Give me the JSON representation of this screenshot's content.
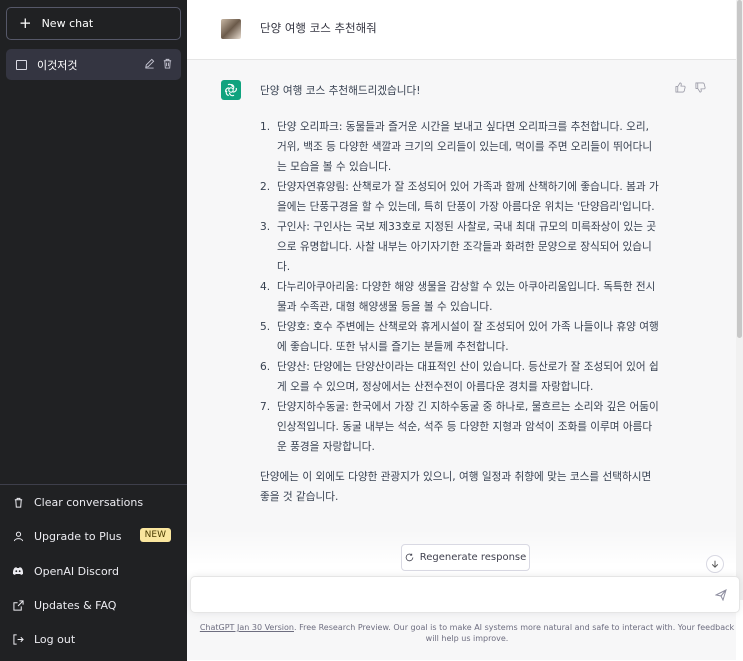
{
  "sidebar": {
    "new_chat_label": "New chat",
    "chat_item_label": "이것저것",
    "menu": {
      "clear": "Clear conversations",
      "upgrade": "Upgrade to Plus",
      "upgrade_badge": "NEW",
      "discord": "OpenAI Discord",
      "updates": "Updates & FAQ",
      "logout": "Log out"
    }
  },
  "conversation": {
    "user_message": "단양 여행 코스 추천해줘",
    "bot_intro": "단양 여행 코스 추천해드리겠습니다!",
    "items": [
      {
        "num": "1.",
        "text": "단양 오리파크: 동물들과 즐거운 시간을 보내고 싶다면 오리파크를 추천합니다. 오리, 거위, 백조 등 다양한 색깔과 크기의 오리들이 있는데, 먹이를 주면 오리들이 뛰어다니는 모습을 볼 수 있습니다."
      },
      {
        "num": "2.",
        "text": "단양자연휴양림: 산책로가 잘 조성되어 있어 가족과 함께 산책하기에 좋습니다. 봄과 가을에는 단풍구경을 할 수 있는데, 특히 단풍이 가장 아름다운 위치는 '단양읍리'입니다."
      },
      {
        "num": "3.",
        "text": "구인사: 구인사는 국보 제33호로 지정된 사찰로, 국내 최대 규모의 미륵좌상이 있는 곳으로 유명합니다. 사찰 내부는 아기자기한 조각들과 화려한 문양으로 장식되어 있습니다."
      },
      {
        "num": "4.",
        "text": "다누리아쿠아리움: 다양한 해양 생물을 감상할 수 있는 아쿠아리움입니다. 독특한 전시물과 수족관, 대형 해양생물 등을 볼 수 있습니다."
      },
      {
        "num": "5.",
        "text": "단양호: 호수 주변에는 산책로와 휴게시설이 잘 조성되어 있어 가족 나들이나 휴양 여행에 좋습니다. 또한 낚시를 즐기는 분들께 추천합니다."
      },
      {
        "num": "6.",
        "text": "단양산: 단양에는 단양산이라는 대표적인 산이 있습니다. 등산로가 잘 조성되어 있어 쉽게 오를 수 있으며, 정상에서는 산전수전이 아름다운 경치를 자랑합니다."
      },
      {
        "num": "7.",
        "text": "단양지하수동굴: 한국에서 가장 긴 지하수동굴 중 하나로, 물흐르는 소리와 깊은 어둠이 인상적입니다. 동굴 내부는 석순, 석주 등 다양한 지형과 암석이 조화를 이루며 아름다운 풍경을 자랑합니다."
      }
    ],
    "bot_outro": "단양에는 이 외에도 다양한 관광지가 있으니, 여행 일정과 취향에 맞는 코스를 선택하시면 좋을 것 같습니다."
  },
  "regenerate_label": "Regenerate response",
  "footer": {
    "link": "ChatGPT Jan 30 Version",
    "text": ". Free Research Preview. Our goal is to make AI systems more natural and safe to interact with. Your feedback will help us improve."
  },
  "colors": {
    "sidebar_bg": "#202123",
    "accent": "#10a37f",
    "badge_bg": "#fae69e"
  }
}
